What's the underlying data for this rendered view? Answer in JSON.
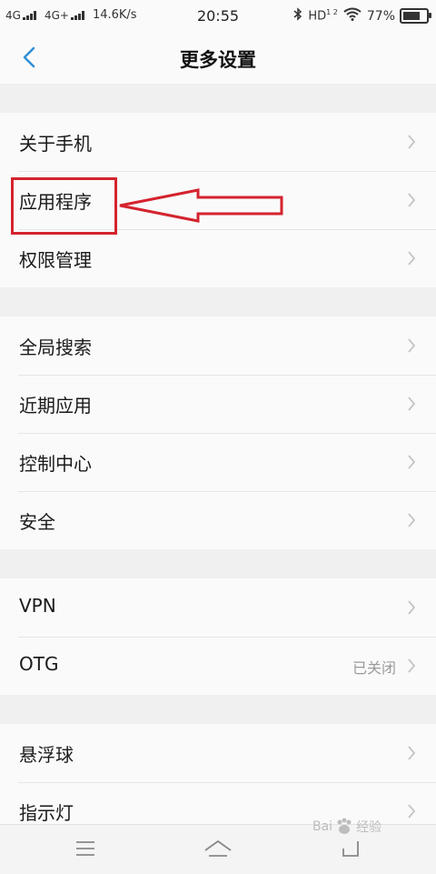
{
  "status_bar": {
    "network1": "4G",
    "network2": "4G+",
    "speed": "14.6K/s",
    "time": "20:55",
    "hd": "HD",
    "hd_sup": "1 2",
    "battery": "77%",
    "battery_level": 0.77
  },
  "header": {
    "title": "更多设置"
  },
  "groups": [
    {
      "items": [
        {
          "label": "关于手机"
        },
        {
          "label": "应用程序"
        },
        {
          "label": "权限管理"
        }
      ]
    },
    {
      "items": [
        {
          "label": "全局搜索"
        },
        {
          "label": "近期应用"
        },
        {
          "label": "控制中心"
        },
        {
          "label": "安全"
        }
      ]
    },
    {
      "items": [
        {
          "label": "VPN"
        },
        {
          "label": "OTG",
          "value": "已关闭"
        }
      ]
    },
    {
      "items": [
        {
          "label": "悬浮球"
        },
        {
          "label": "指示灯"
        }
      ]
    }
  ],
  "watermark": {
    "text_left": "Bai",
    "text_right": "经验"
  },
  "colors": {
    "accent": "#2e8fd6",
    "annotation": "#d4232e",
    "chevron": "#c4c4c4"
  },
  "icons": {
    "back": "chevron-left-icon",
    "row_arrow": "chevron-right-icon",
    "nav_menu": "menu-icon",
    "nav_home": "home-icon",
    "nav_back": "back-icon"
  }
}
